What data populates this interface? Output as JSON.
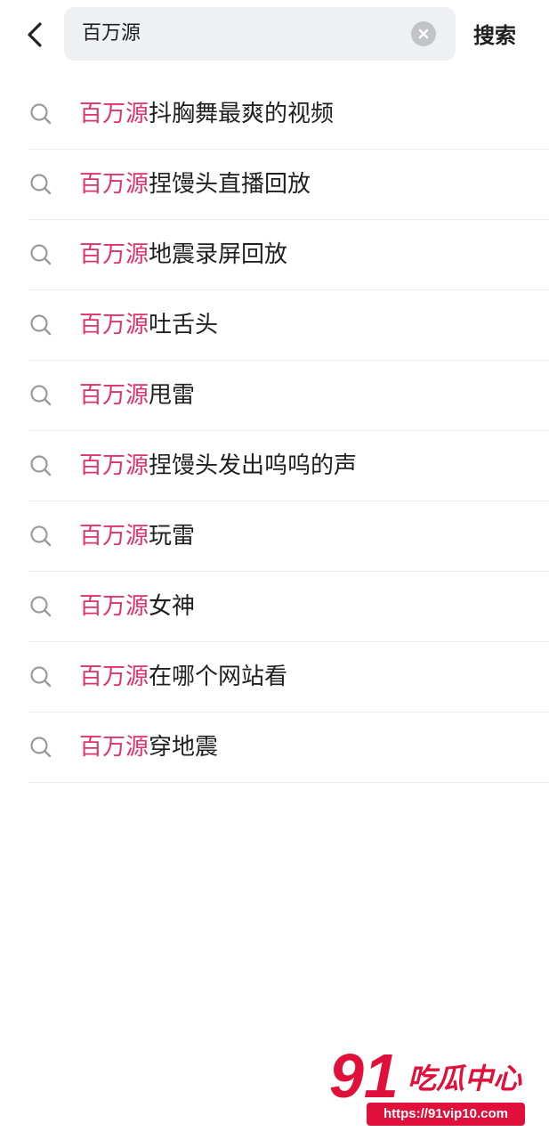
{
  "search": {
    "query": "百万源",
    "submit_label": "搜索"
  },
  "colors": {
    "highlight": "#e1306c",
    "text": "#1f1f1f",
    "divider": "#ececec",
    "searchbox_bg": "#eef0f3"
  },
  "suggestions": [
    {
      "highlight": "百万源",
      "rest": "抖胸舞最爽的视频"
    },
    {
      "highlight": "百万源",
      "rest": "捏馒头直播回放"
    },
    {
      "highlight": "百万源",
      "rest": "地震录屏回放"
    },
    {
      "highlight": "百万源",
      "rest": "吐舌头"
    },
    {
      "highlight": "百万源",
      "rest": "甩雷"
    },
    {
      "highlight": "百万源",
      "rest": "捏馒头发出呜呜的声"
    },
    {
      "highlight": "百万源",
      "rest": "玩雷"
    },
    {
      "highlight": "百万源",
      "rest": "女神"
    },
    {
      "highlight": "百万源",
      "rest": "在哪个网站看"
    },
    {
      "highlight": "百万源",
      "rest": "穿地震"
    }
  ],
  "watermark": {
    "number": "91",
    "name": "吃瓜中心",
    "url": "https://91vip10.com"
  }
}
